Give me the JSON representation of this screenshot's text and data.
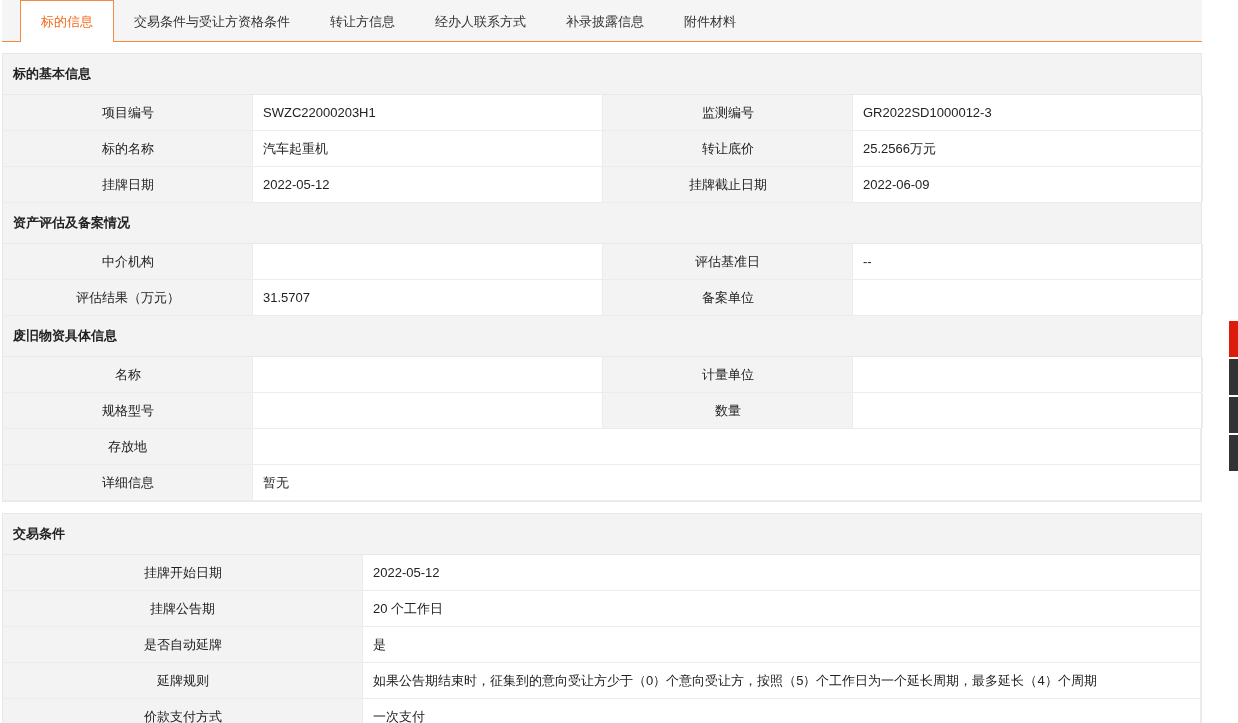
{
  "tabs": [
    {
      "label": "标的信息",
      "selected": true
    },
    {
      "label": "交易条件与受让方资格条件",
      "selected": false
    },
    {
      "label": "转让方信息",
      "selected": false
    },
    {
      "label": "经办人联系方式",
      "selected": false
    },
    {
      "label": "补录披露信息",
      "selected": false
    },
    {
      "label": "附件材料",
      "selected": false
    }
  ],
  "panels": [
    {
      "kind": "four",
      "groups": [
        {
          "title": "标的基本信息",
          "rows": [
            {
              "cells": [
                {
                  "label": "项目编号",
                  "value": "SWZC22000203H1"
                },
                {
                  "label": "监测编号",
                  "value": "GR2022SD1000012-3"
                }
              ]
            },
            {
              "cells": [
                {
                  "label": "标的名称",
                  "value": "汽车起重机"
                },
                {
                  "label": "转让底价",
                  "value": "25.2566万元"
                }
              ]
            },
            {
              "cells": [
                {
                  "label": "挂牌日期",
                  "value": "2022-05-12"
                },
                {
                  "label": "挂牌截止日期",
                  "value": "2022-06-09"
                }
              ]
            }
          ]
        },
        {
          "title": "资产评估及备案情况",
          "rows": [
            {
              "cells": [
                {
                  "label": "中介机构"
                },
                {
                  "label": "评估基准日",
                  "value": "--"
                }
              ]
            },
            {
              "cells": [
                {
                  "label": "评估结果（万元）",
                  "value": "31.5707"
                },
                {
                  "label": "备案单位"
                }
              ]
            }
          ]
        },
        {
          "title": "废旧物资具体信息",
          "rows": [
            {
              "cells": [
                {
                  "label": "名称"
                },
                {
                  "label": "计量单位"
                }
              ]
            },
            {
              "cells": [
                {
                  "label": "规格型号"
                },
                {
                  "label": "数量"
                }
              ]
            },
            {
              "cells": [
                {
                  "label": "存放地"
                }
              ]
            },
            {
              "cells": [
                {
                  "label": "详细信息",
                  "value": "暂无"
                }
              ]
            }
          ]
        }
      ]
    },
    {
      "kind": "two",
      "groups": [
        {
          "title": "交易条件",
          "rows": [
            {
              "cells": [
                {
                  "label": "挂牌开始日期",
                  "value": "2022-05-12"
                }
              ]
            },
            {
              "cells": [
                {
                  "label": "挂牌公告期",
                  "value": "20 个工作日"
                }
              ]
            },
            {
              "cells": [
                {
                  "label": "是否自动延牌",
                  "value": "是"
                }
              ]
            },
            {
              "cells": [
                {
                  "label": "延牌规则",
                  "value": "如果公告期结束时，征集到的意向受让方少于（0）个意向受让方，按照（5）个工作日为一个延长周期，最多延长（4）个周期"
                }
              ]
            },
            {
              "cells": [
                {
                  "label": "价款支付方式",
                  "value": "一次支付"
                }
              ]
            }
          ]
        }
      ]
    }
  ],
  "side_buttons": [
    {
      "color": "#dd1c0c"
    },
    {
      "color": "#333333"
    },
    {
      "color": "#333333"
    },
    {
      "color": "#333333"
    }
  ]
}
